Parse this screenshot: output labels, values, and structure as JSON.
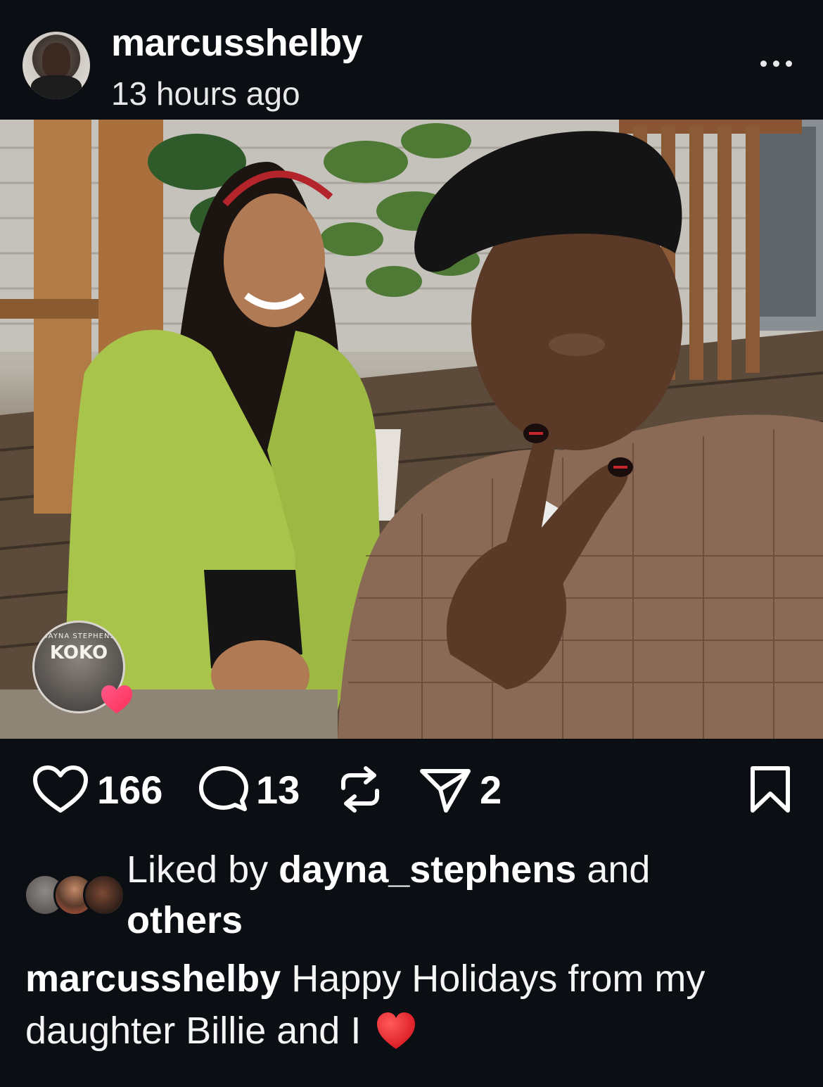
{
  "post": {
    "username": "marcusshelby",
    "timestamp": "13 hours ago",
    "more_icon": "ellipsis-icon"
  },
  "actions": {
    "likes": "166",
    "comments": "13",
    "shares": "2",
    "icons": [
      "heart-icon",
      "comment-icon",
      "repost-icon",
      "send-icon",
      "bookmark-icon"
    ]
  },
  "liked_by": {
    "prefix": "Liked by",
    "user": "dayna_stephens",
    "suffix": "and",
    "others": "others"
  },
  "caption": {
    "username": "marcusshelby",
    "text": "Happy Holidays from my daughter Billie and I",
    "emoji": "❤️"
  },
  "tag_badge": {
    "label": "DAYNA STEPHENS",
    "logo": "KOKO"
  },
  "colors": {
    "background": "#0b0f13",
    "text": "#f5f5f5",
    "heart_red": "#e0202a",
    "badge_heart": "#ff3d7f"
  }
}
